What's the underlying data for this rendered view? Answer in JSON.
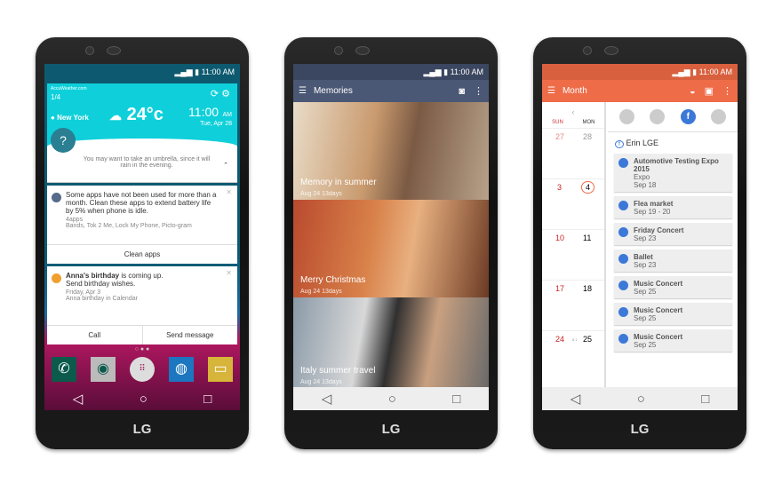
{
  "brand": "LG",
  "status": {
    "time": "11:00 AM"
  },
  "phone1": {
    "weather": {
      "source": "AccuWeather.com",
      "page": "1/4",
      "city": "New York",
      "temp": "24°c",
      "time": "11:00",
      "ampm": "AM",
      "date": "Tue, Apr 28",
      "tip": "You may want to take an umbrella, since it will rain in the evening."
    },
    "notif1": {
      "text": "Some apps have not been used for more than a month. Clean these apps to extend battery life by 5% when phone is idle.",
      "sub1": "4apps",
      "sub2": "Bands, Tok 2 Me, Lock My Phone, Picto-gram",
      "action": "Clean apps"
    },
    "notif2": {
      "name": "Anna's birthday",
      "text": " is coming up.",
      "text2": "Send birthday wishes.",
      "sub1": "Friday, Apr 3",
      "sub2": "Anna birthday in Calendar",
      "action1": "Call",
      "action2": "Send message"
    }
  },
  "phone2": {
    "title": "Memories",
    "albums": [
      {
        "title": "Memory in summer",
        "date": "Aug 24 13days"
      },
      {
        "title": "Merry Christmas",
        "date": "Aug 24 13days"
      },
      {
        "title": "Italy summer travel",
        "date": "Aug 24 13days"
      }
    ]
  },
  "phone3": {
    "title": "Month",
    "days": [
      "SUN",
      "MON"
    ],
    "weeks": [
      [
        "27",
        "28"
      ],
      [
        "3",
        "4"
      ],
      [
        "10",
        "11"
      ],
      [
        "17",
        "18"
      ],
      [
        "24",
        "25"
      ]
    ],
    "week_note": "8.1",
    "account": "Erin LGE",
    "events": [
      {
        "title": "Automotive Testing Expo 2015",
        "sub": "Expo",
        "date": "Sep 18"
      },
      {
        "title": "Flea market",
        "date": "Sep 19 - 20"
      },
      {
        "title": "Friday Concert",
        "date": "Sep 23"
      },
      {
        "title": "Ballet",
        "date": "Sep 23"
      },
      {
        "title": "Music Concert",
        "date": "Sep 25"
      },
      {
        "title": "Music Concert",
        "date": "Sep 25"
      },
      {
        "title": "Music Concert",
        "date": "Sep 25"
      }
    ],
    "accent": "#ef6c49"
  }
}
